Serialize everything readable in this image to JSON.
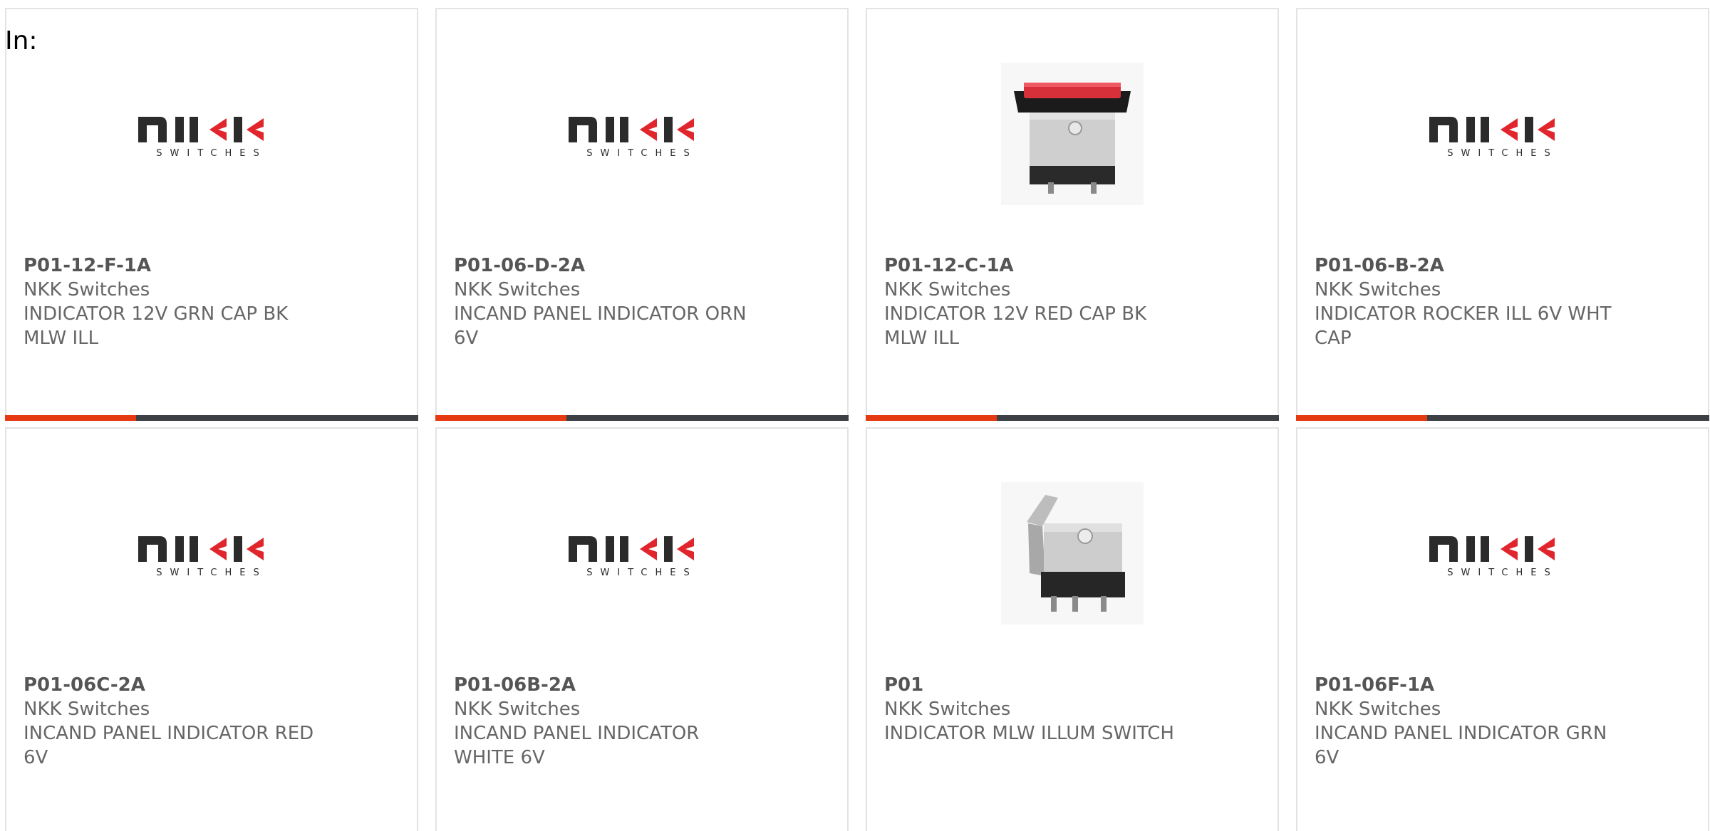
{
  "header": {
    "in_label": "In:"
  },
  "colors": {
    "accent": "#e63a12",
    "bar": "#3d4145",
    "logo_red": "#e0262c",
    "logo_dark": "#2b2b2b"
  },
  "products": [
    {
      "part": "P01-12-F-1A",
      "brand": "NKK Switches",
      "desc": "INDICATOR 12V GRN CAP BK MLW ILL",
      "image": "nkk-logo",
      "logo_text": "SWITCHES"
    },
    {
      "part": "P01-06-D-2A",
      "brand": "NKK Switches",
      "desc": "INCAND PANEL INDICATOR ORN 6V",
      "image": "nkk-logo",
      "logo_text": "SWITCHES"
    },
    {
      "part": "P01-12-C-1A",
      "brand": "NKK Switches",
      "desc": "INDICATOR 12V RED CAP BK MLW ILL",
      "image": "rocker-red-photo"
    },
    {
      "part": "P01-06-B-2A",
      "brand": "NKK Switches",
      "desc": "INDICATOR ROCKER ILL 6V WHT CAP",
      "image": "nkk-logo",
      "logo_text": "SWITCHES"
    },
    {
      "part": "P01-06C-2A",
      "brand": "NKK Switches",
      "desc": "INCAND PANEL INDICATOR RED 6V",
      "image": "nkk-logo",
      "logo_text": "SWITCHES"
    },
    {
      "part": "P01-06B-2A",
      "brand": "NKK Switches",
      "desc": "INCAND PANEL INDICATOR WHITE 6V",
      "image": "nkk-logo",
      "logo_text": "SWITCHES"
    },
    {
      "part": "P01",
      "brand": "NKK Switches",
      "desc": "INDICATOR MLW ILLUM SWITCH",
      "image": "switch-body-photo"
    },
    {
      "part": "P01-06F-1A",
      "brand": "NKK Switches",
      "desc": "INCAND PANEL INDICATOR GRN 6V",
      "image": "nkk-logo",
      "logo_text": "SWITCHES"
    }
  ]
}
